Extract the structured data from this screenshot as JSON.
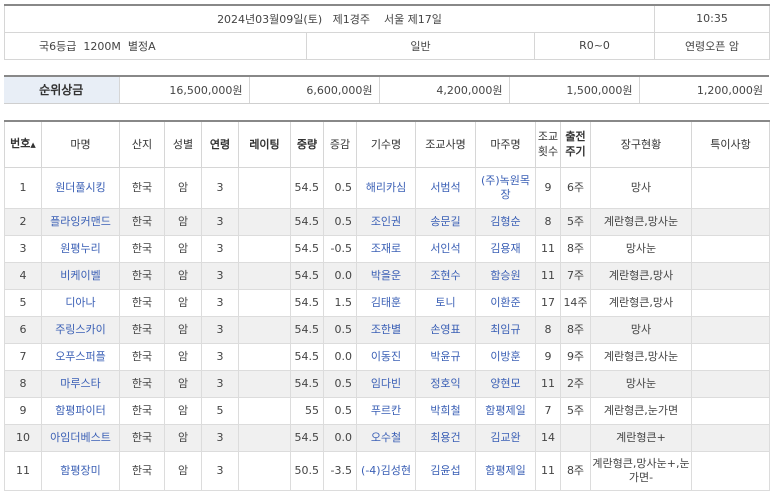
{
  "race_info": {
    "date_time": "2024년03월09일(토)   제1경주    서울 제17일",
    "start_time": "10:35",
    "class_distance": "국6등급  1200M  별정A",
    "race_type": "일반",
    "rating": "R0~0",
    "age_sex": "연령오픈 암"
  },
  "prize": {
    "label": "순위상금",
    "amounts": [
      "16,500,000원",
      "6,600,000원",
      "4,200,000원",
      "1,500,000원",
      "1,200,000원"
    ]
  },
  "columns": {
    "no": "번호",
    "sort_icon": "▲",
    "horse": "마명",
    "origin": "산지",
    "sex": "성별",
    "age": "연령",
    "rating": "레이팅",
    "weight": "중량",
    "change": "증감",
    "jockey": "기수명",
    "trainer": "조교사명",
    "owner": "마주명",
    "train_count_1": "조교",
    "train_count_2": "횟수",
    "cycle_1": "출전",
    "cycle_2": "주기",
    "gear": "장구현황",
    "notes": "특이사항"
  },
  "rows": [
    {
      "no": "1",
      "horse": "원더풀시킹",
      "origin": "한국",
      "sex": "암",
      "age": "3",
      "rating": "",
      "weight": "54.5",
      "change": "0.5",
      "jockey": "해리카심",
      "trainer": "서범석",
      "owner": "(주)녹원목장",
      "train_count": "9",
      "cycle": "6주",
      "gear": "망사",
      "notes": ""
    },
    {
      "no": "2",
      "horse": "플라잉커맨드",
      "origin": "한국",
      "sex": "암",
      "age": "3",
      "rating": "",
      "weight": "54.5",
      "change": "0.5",
      "jockey": "조인권",
      "trainer": "송문길",
      "owner": "김형순",
      "train_count": "8",
      "cycle": "5주",
      "gear": "계란형큰,망사눈",
      "notes": ""
    },
    {
      "no": "3",
      "horse": "원평누리",
      "origin": "한국",
      "sex": "암",
      "age": "3",
      "rating": "",
      "weight": "54.5",
      "change": "-0.5",
      "jockey": "조재로",
      "trainer": "서인석",
      "owner": "김용재",
      "train_count": "11",
      "cycle": "8주",
      "gear": "망사눈",
      "notes": ""
    },
    {
      "no": "4",
      "horse": "비케이벨",
      "origin": "한국",
      "sex": "암",
      "age": "3",
      "rating": "",
      "weight": "54.5",
      "change": "0.0",
      "jockey": "박을운",
      "trainer": "조현수",
      "owner": "함승원",
      "train_count": "11",
      "cycle": "7주",
      "gear": "계란형큰,망사",
      "notes": ""
    },
    {
      "no": "5",
      "horse": "디아나",
      "origin": "한국",
      "sex": "암",
      "age": "3",
      "rating": "",
      "weight": "54.5",
      "change": "1.5",
      "jockey": "김태훈",
      "trainer": "토니",
      "owner": "이환준",
      "train_count": "17",
      "cycle": "14주",
      "gear": "계란형큰,망사",
      "notes": ""
    },
    {
      "no": "6",
      "horse": "주링스카이",
      "origin": "한국",
      "sex": "암",
      "age": "3",
      "rating": "",
      "weight": "54.5",
      "change": "0.5",
      "jockey": "조한별",
      "trainer": "손영표",
      "owner": "최임규",
      "train_count": "8",
      "cycle": "8주",
      "gear": "망사",
      "notes": ""
    },
    {
      "no": "7",
      "horse": "오푸스퍼플",
      "origin": "한국",
      "sex": "암",
      "age": "3",
      "rating": "",
      "weight": "54.5",
      "change": "0.0",
      "jockey": "이동진",
      "trainer": "박윤규",
      "owner": "이방훈",
      "train_count": "9",
      "cycle": "9주",
      "gear": "계란형큰,망사눈",
      "notes": ""
    },
    {
      "no": "8",
      "horse": "마루스타",
      "origin": "한국",
      "sex": "암",
      "age": "3",
      "rating": "",
      "weight": "54.5",
      "change": "0.5",
      "jockey": "임다빈",
      "trainer": "정호익",
      "owner": "양현모",
      "train_count": "11",
      "cycle": "2주",
      "gear": "망사눈",
      "notes": ""
    },
    {
      "no": "9",
      "horse": "함평파이터",
      "origin": "한국",
      "sex": "암",
      "age": "5",
      "rating": "",
      "weight": "55",
      "change": "0.5",
      "jockey": "푸르칸",
      "trainer": "박희철",
      "owner": "함평제일",
      "train_count": "7",
      "cycle": "5주",
      "gear": "계란형큰,눈가면",
      "notes": ""
    },
    {
      "no": "10",
      "horse": "아임더베스트",
      "origin": "한국",
      "sex": "암",
      "age": "3",
      "rating": "",
      "weight": "54.5",
      "change": "0.0",
      "jockey": "오수철",
      "trainer": "최용건",
      "owner": "김교완",
      "train_count": "14",
      "cycle": "",
      "gear": "계란형큰+",
      "notes": ""
    },
    {
      "no": "11",
      "horse": "함평장미",
      "origin": "한국",
      "sex": "암",
      "age": "3",
      "rating": "",
      "weight": "50.5",
      "change": "-3.5",
      "jockey": "(-4)김성현",
      "trainer": "김윤섭",
      "owner": "함평제일",
      "train_count": "11",
      "cycle": "8주",
      "gear": "계란형큰,망사눈+,눈가면-",
      "notes": ""
    }
  ]
}
